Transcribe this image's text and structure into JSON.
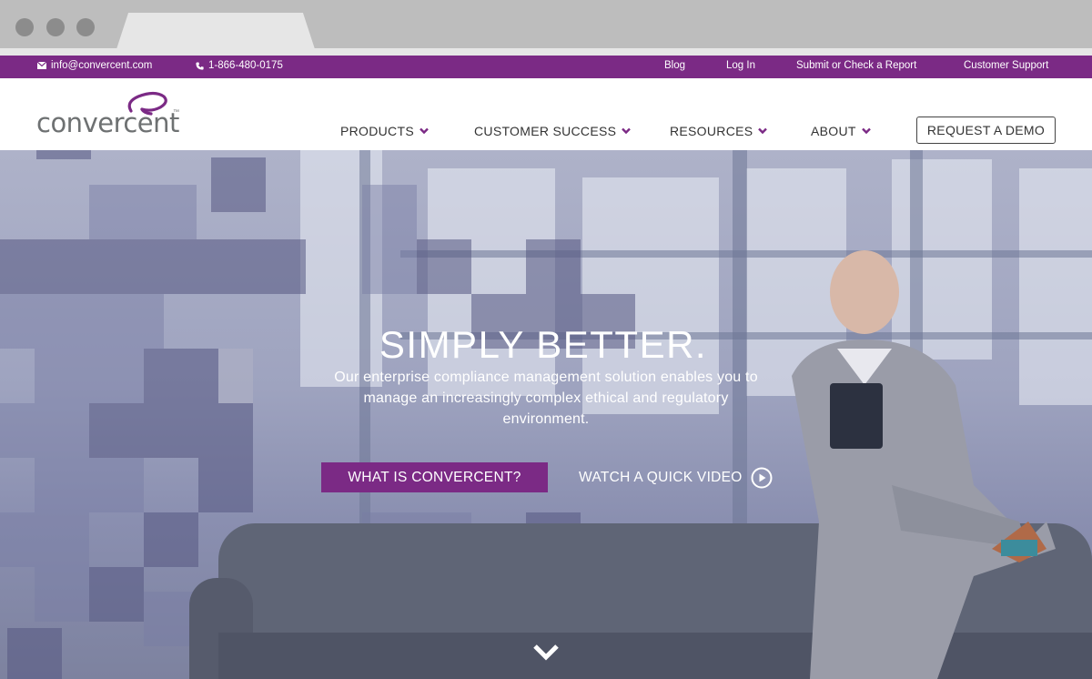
{
  "topbar": {
    "email": "info@convercent.com",
    "phone": "1-866-480-0175",
    "links": [
      "Blog",
      "Log In",
      "Submit or Check a Report",
      "Customer Support"
    ]
  },
  "brand": {
    "name": "convercent",
    "trademark": "™"
  },
  "nav": {
    "items": [
      "PRODUCTS",
      "CUSTOMER SUCCESS",
      "RESOURCES",
      "ABOUT"
    ],
    "cta": "REQUEST A DEMO"
  },
  "hero": {
    "title": "SIMPLY BETTER.",
    "subtitle": "Our enterprise compliance management solution enables you to manage an increasingly complex ethical and regulatory environment.",
    "primary_cta": "WHAT IS CONVERCENT?",
    "video_cta": "WATCH A QUICK VIDEO"
  },
  "colors": {
    "brand_purple": "#7b2a85",
    "text_dark": "#333333",
    "logo_gray": "#6e7172"
  }
}
